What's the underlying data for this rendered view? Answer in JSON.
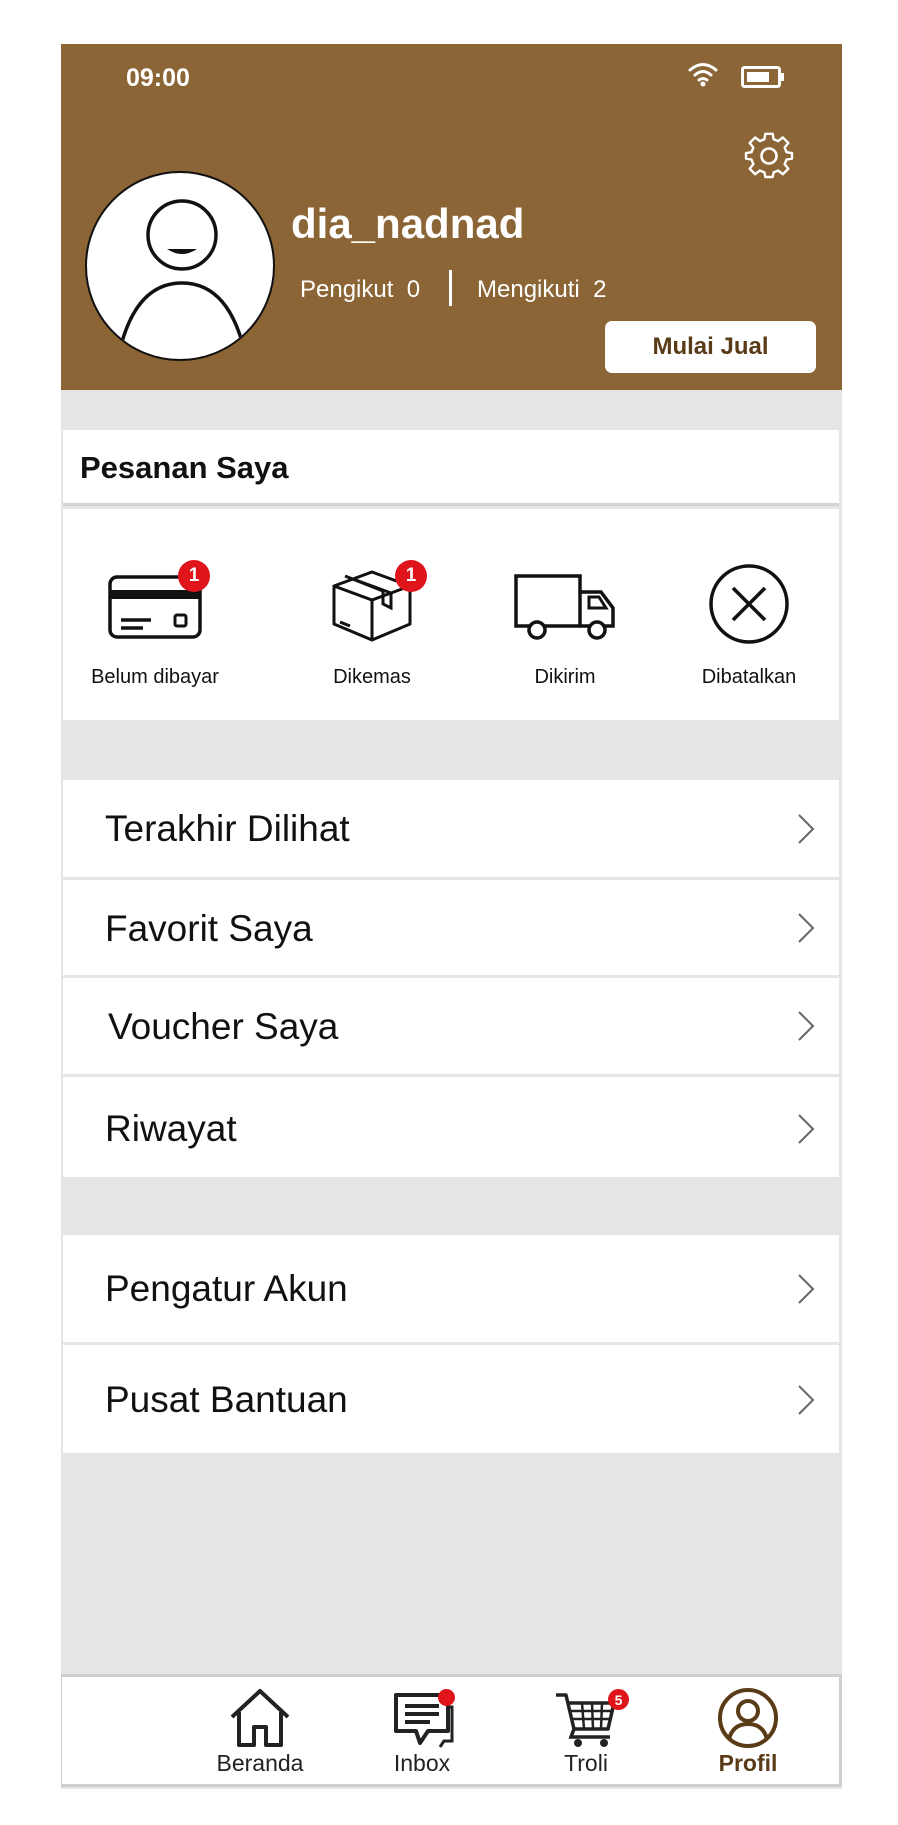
{
  "status_bar": {
    "time": "09:00"
  },
  "profile": {
    "username": "dia_nadnad",
    "followers_label": "Pengikut",
    "followers_count": "0",
    "following_label": "Mengikuti",
    "following_count": "2",
    "sell_button": "Mulai Jual"
  },
  "orders": {
    "title": "Pesanan Saya",
    "items": [
      {
        "label": "Belum dibayar",
        "icon": "credit-card-icon",
        "badge": "1"
      },
      {
        "label": "Dikemas",
        "icon": "package-icon",
        "badge": "1"
      },
      {
        "label": "Dikirim",
        "icon": "truck-icon",
        "badge": ""
      },
      {
        "label": "Dibatalkan",
        "icon": "cancel-circle-icon",
        "badge": ""
      }
    ]
  },
  "menu_group_1": [
    {
      "label": "Terakhir Dilihat"
    },
    {
      "label": "Favorit Saya"
    },
    {
      "label": "Voucher Saya"
    },
    {
      "label": "Riwayat"
    }
  ],
  "menu_group_2": [
    {
      "label": "Pengatur Akun"
    },
    {
      "label": "Pusat Bantuan"
    }
  ],
  "bottom_nav": {
    "items": [
      {
        "label": "Beranda",
        "icon": "home-icon"
      },
      {
        "label": "Inbox",
        "icon": "chat-icon"
      },
      {
        "label": "Troli",
        "icon": "cart-icon",
        "badge": "5"
      },
      {
        "label": "Profil",
        "icon": "profile-icon",
        "active": true
      }
    ]
  },
  "colors": {
    "header_bg": "#8b6536",
    "accent_text": "#5a3b17",
    "badge": "#e0141b",
    "page_bg": "#e5e5e5"
  }
}
